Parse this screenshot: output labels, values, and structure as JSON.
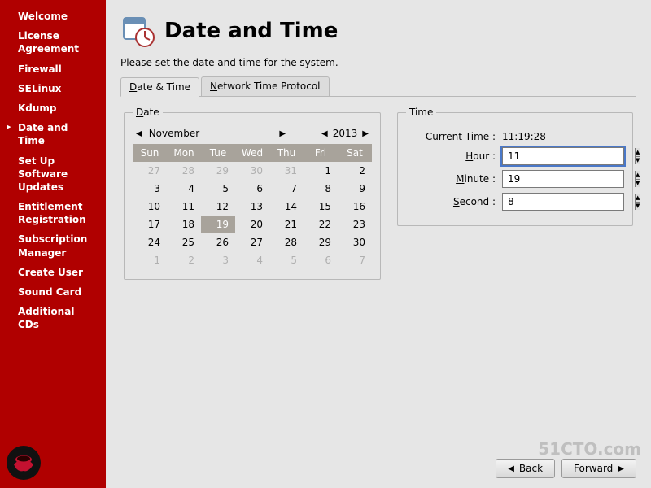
{
  "sidebar": {
    "items": [
      {
        "label": "Welcome"
      },
      {
        "label": "License Agreement"
      },
      {
        "label": "Firewall"
      },
      {
        "label": "SELinux"
      },
      {
        "label": "Kdump"
      },
      {
        "label": "Date and Time"
      },
      {
        "label": "Set Up Software Updates"
      },
      {
        "label": "Entitlement Registration"
      },
      {
        "label": "Subscription Manager"
      },
      {
        "label": "Create User"
      },
      {
        "label": "Sound Card"
      },
      {
        "label": "Additional CDs"
      }
    ],
    "active_index": 5
  },
  "header": {
    "title": "Date and Time",
    "instruction": "Please set the date and time for the system."
  },
  "tabs": [
    {
      "label": "Date & Time"
    },
    {
      "label": "Network Time Protocol"
    }
  ],
  "date": {
    "legend": "Date",
    "month_label": "November",
    "year_label": "2013",
    "weekdays": [
      "Sun",
      "Mon",
      "Tue",
      "Wed",
      "Thu",
      "Fri",
      "Sat"
    ],
    "grid": [
      [
        {
          "d": 27,
          "o": true
        },
        {
          "d": 28,
          "o": true
        },
        {
          "d": 29,
          "o": true
        },
        {
          "d": 30,
          "o": true
        },
        {
          "d": 31,
          "o": true
        },
        {
          "d": 1
        },
        {
          "d": 2
        }
      ],
      [
        {
          "d": 3
        },
        {
          "d": 4
        },
        {
          "d": 5
        },
        {
          "d": 6
        },
        {
          "d": 7
        },
        {
          "d": 8
        },
        {
          "d": 9
        }
      ],
      [
        {
          "d": 10
        },
        {
          "d": 11
        },
        {
          "d": 12
        },
        {
          "d": 13
        },
        {
          "d": 14
        },
        {
          "d": 15
        },
        {
          "d": 16
        }
      ],
      [
        {
          "d": 17
        },
        {
          "d": 18
        },
        {
          "d": 19,
          "sel": true
        },
        {
          "d": 20
        },
        {
          "d": 21
        },
        {
          "d": 22
        },
        {
          "d": 23
        }
      ],
      [
        {
          "d": 24
        },
        {
          "d": 25
        },
        {
          "d": 26
        },
        {
          "d": 27
        },
        {
          "d": 28
        },
        {
          "d": 29
        },
        {
          "d": 30
        }
      ],
      [
        {
          "d": 1,
          "o": true
        },
        {
          "d": 2,
          "o": true
        },
        {
          "d": 3,
          "o": true
        },
        {
          "d": 4,
          "o": true
        },
        {
          "d": 5,
          "o": true
        },
        {
          "d": 6,
          "o": true
        },
        {
          "d": 7,
          "o": true
        }
      ]
    ]
  },
  "time": {
    "legend": "Time",
    "current_label": "Current Time :",
    "current_value": "11:19:28",
    "hour_label": "Hour :",
    "hour_value": "11",
    "minute_label": "Minute :",
    "minute_value": "19",
    "second_label": "Second :",
    "second_value": "8"
  },
  "footer": {
    "back": "Back",
    "forward": "Forward"
  },
  "watermark": "51CTO.com"
}
